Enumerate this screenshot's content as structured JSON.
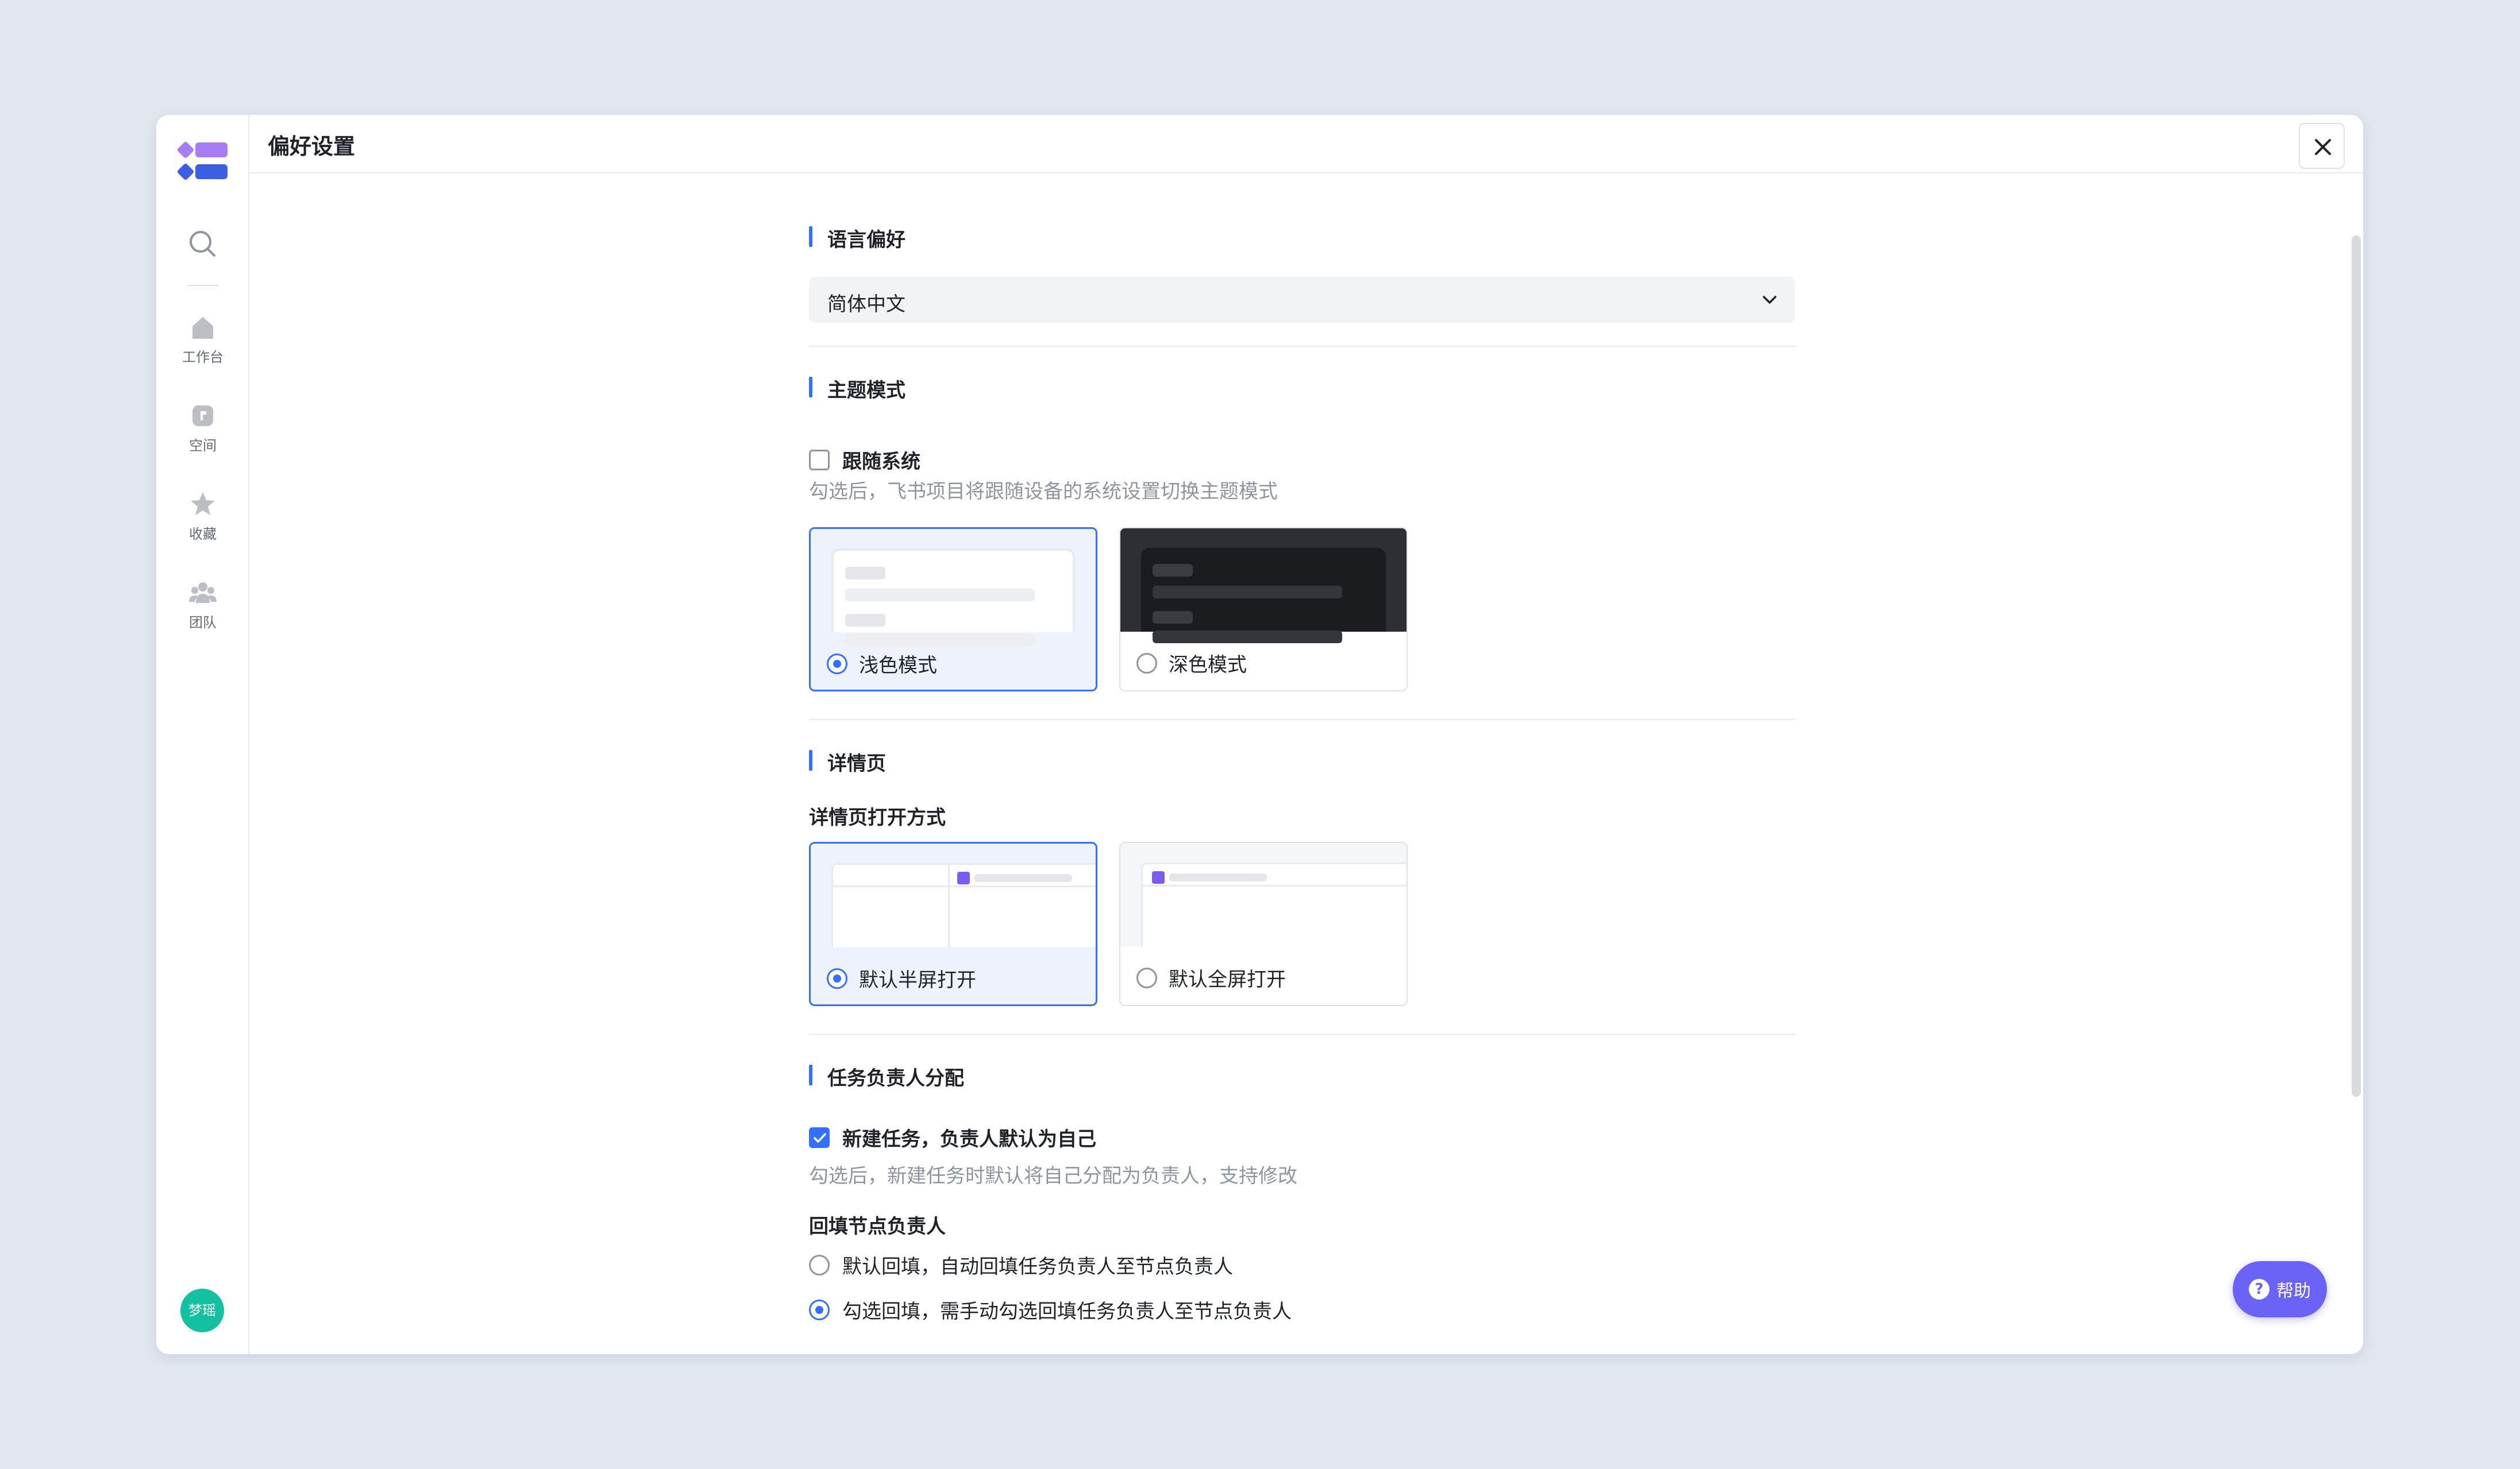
{
  "window": {
    "title": "偏好设置"
  },
  "sidebar": {
    "items": [
      {
        "label": "工作台",
        "icon": "home-icon"
      },
      {
        "label": "空间",
        "icon": "space-icon"
      },
      {
        "label": "收藏",
        "icon": "star-icon"
      },
      {
        "label": "团队",
        "icon": "team-icon"
      }
    ],
    "avatar_text": "梦瑶"
  },
  "language": {
    "title": "语言偏好",
    "selected": "简体中文"
  },
  "theme": {
    "title": "主题模式",
    "follow_system_label": "跟随系统",
    "follow_system_checked": false,
    "follow_system_desc": "勾选后，飞书项目将跟随设备的系统设置切换主题模式",
    "options": [
      {
        "label": "浅色模式",
        "selected": true
      },
      {
        "label": "深色模式",
        "selected": false
      }
    ]
  },
  "detail": {
    "title": "详情页",
    "open_mode_label": "详情页打开方式",
    "options": [
      {
        "label": "默认半屏打开",
        "selected": true
      },
      {
        "label": "默认全屏打开",
        "selected": false
      }
    ]
  },
  "assignee": {
    "title": "任务负责人分配",
    "self_default_label": "新建任务，负责人默认为自己",
    "self_default_checked": true,
    "self_default_desc": "勾选后，新建任务时默认将自己分配为负责人，支持修改",
    "backfill_title": "回填节点负责人",
    "backfill_options": [
      {
        "label": "默认回填，自动回填任务负责人至节点负责人",
        "selected": false
      },
      {
        "label": "勾选回填，需手动勾选回填任务负责人至节点负责人",
        "selected": true
      }
    ]
  },
  "help": {
    "label": "帮助",
    "glyph": "?"
  },
  "colors": {
    "accent": "#3370ff",
    "help_button": "#6b63f6",
    "avatar": "#14c0a2"
  }
}
